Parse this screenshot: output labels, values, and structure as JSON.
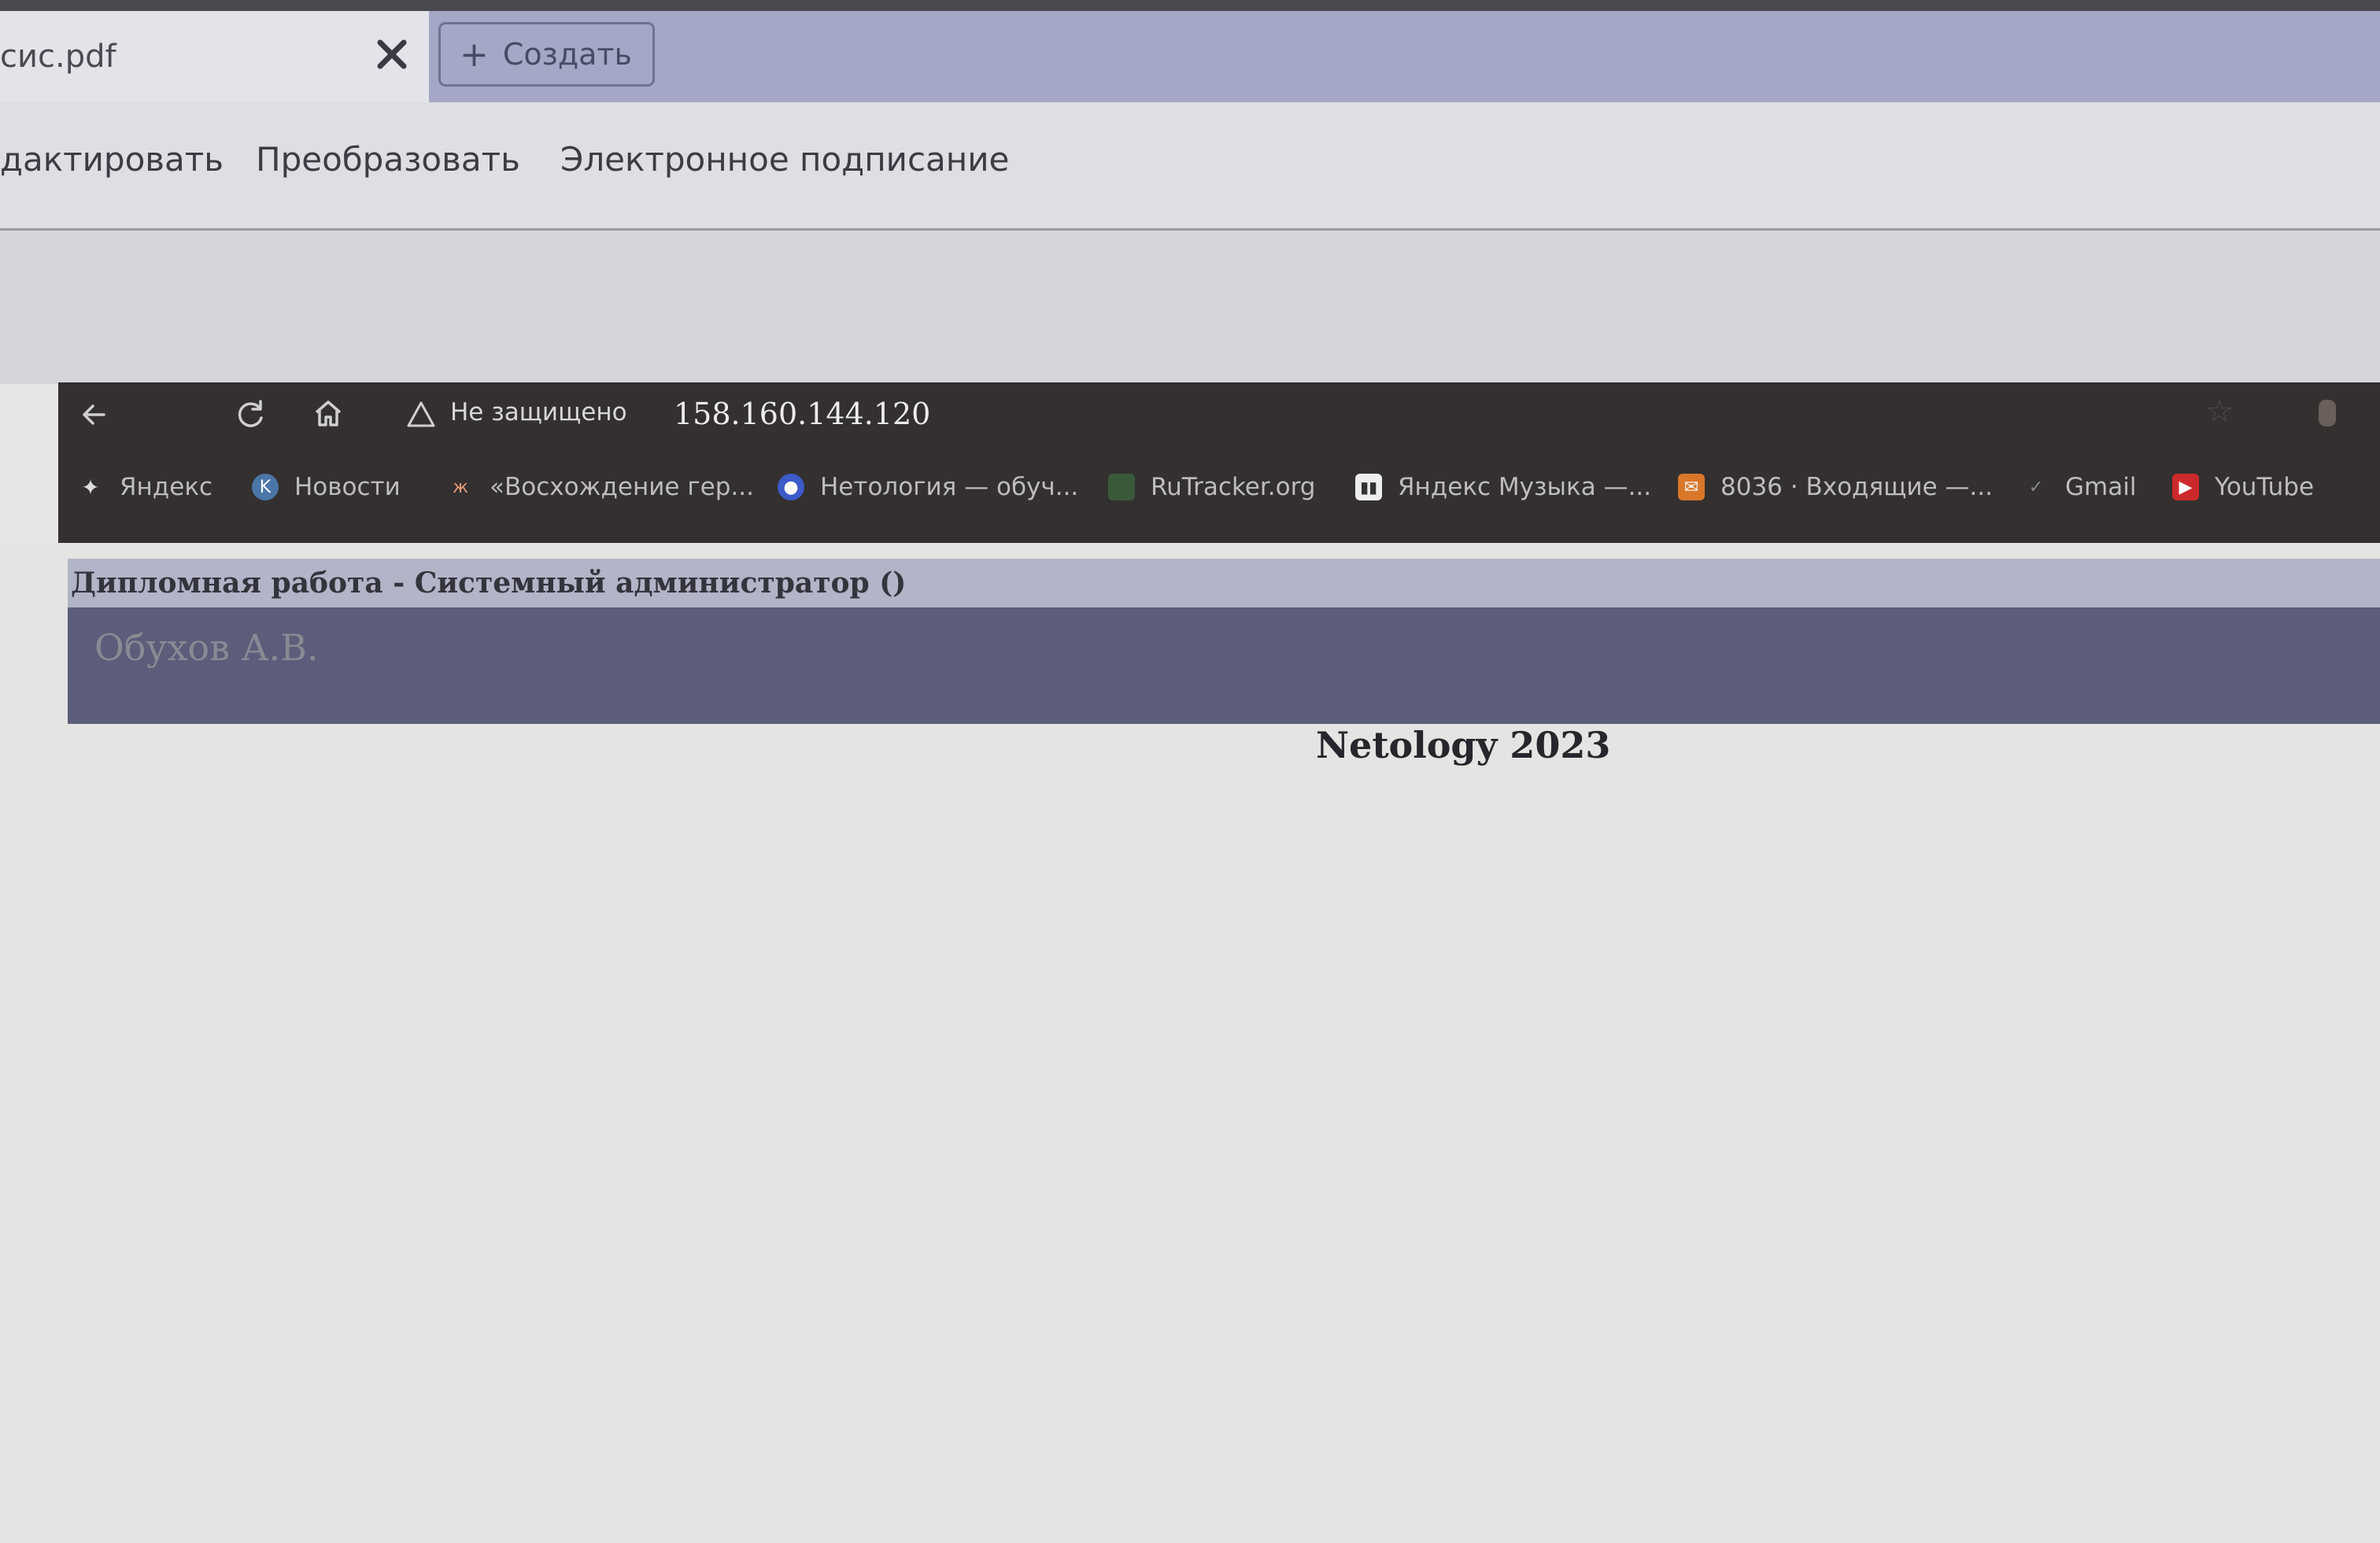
{
  "pdf_app": {
    "tab_title": "сис.pdf",
    "new_tab_label": "Создать",
    "menu": [
      "дактировать",
      "Преобразовать",
      "Электронное подписание"
    ]
  },
  "browser": {
    "security_label": "Не защищено",
    "address": "158.160.144.120",
    "bookmarks": [
      {
        "label": "Яндекс",
        "icon": "star-icon"
      },
      {
        "label": "Новости",
        "icon": "vk-icon"
      },
      {
        "label": "«Восхождение гер...",
        "icon": "fox-icon"
      },
      {
        "label": "Нетология — обуч...",
        "icon": "netology-icon"
      },
      {
        "label": "RuTracker.org",
        "icon": "rutracker-icon"
      },
      {
        "label": "Яндекс Музыка —...",
        "icon": "music-icon"
      },
      {
        "label": "8036 · Входящие —...",
        "icon": "mail-icon"
      },
      {
        "label": "Gmail",
        "icon": "gmail-icon"
      },
      {
        "label": "YouTube",
        "icon": "youtube-icon"
      }
    ]
  },
  "page": {
    "title": "Дипломная работа - Системный администратор ()",
    "author": "Обухов А.В.",
    "footer": "Netology 2023"
  }
}
